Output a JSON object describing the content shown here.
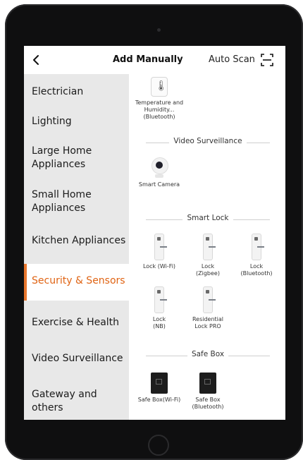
{
  "header": {
    "title": "Add Manually",
    "auto_scan": "Auto Scan"
  },
  "sidebar": {
    "items": [
      {
        "label": "Electrician"
      },
      {
        "label": "Lighting"
      },
      {
        "label": "Large Home Appliances"
      },
      {
        "label": "Small Home Appliances"
      },
      {
        "label": "Kitchen Appliances"
      },
      {
        "label": "Security & Sensors",
        "active": true
      },
      {
        "label": "Exercise & Health"
      },
      {
        "label": "Video Surveillance"
      },
      {
        "label": "Gateway and others"
      }
    ]
  },
  "sections": {
    "top_device": {
      "label": "Temperature and Humidity... (Bluetooth)",
      "icon": "thermometer-icon"
    },
    "video": {
      "title": "Video Surveillance",
      "devices": [
        {
          "label": "Smart Camera",
          "icon": "camera-icon"
        }
      ]
    },
    "lock": {
      "title": "Smart Lock",
      "devices": [
        {
          "label": "Lock (Wi-Fi)"
        },
        {
          "label": "Lock (Zigbee)"
        },
        {
          "label": "Lock (Bluetooth)"
        },
        {
          "label": "Lock (NB)"
        },
        {
          "label": "Residential Lock PRO"
        }
      ]
    },
    "safe": {
      "title": "Safe Box",
      "devices": [
        {
          "label": "Safe Box(Wi-Fi)"
        },
        {
          "label": "Safe Box (Bluetooth)"
        }
      ]
    }
  },
  "colors": {
    "accent": "#e06414",
    "sidebar_bg": "#e8e8e8",
    "device_frame": "#0f0f10"
  }
}
